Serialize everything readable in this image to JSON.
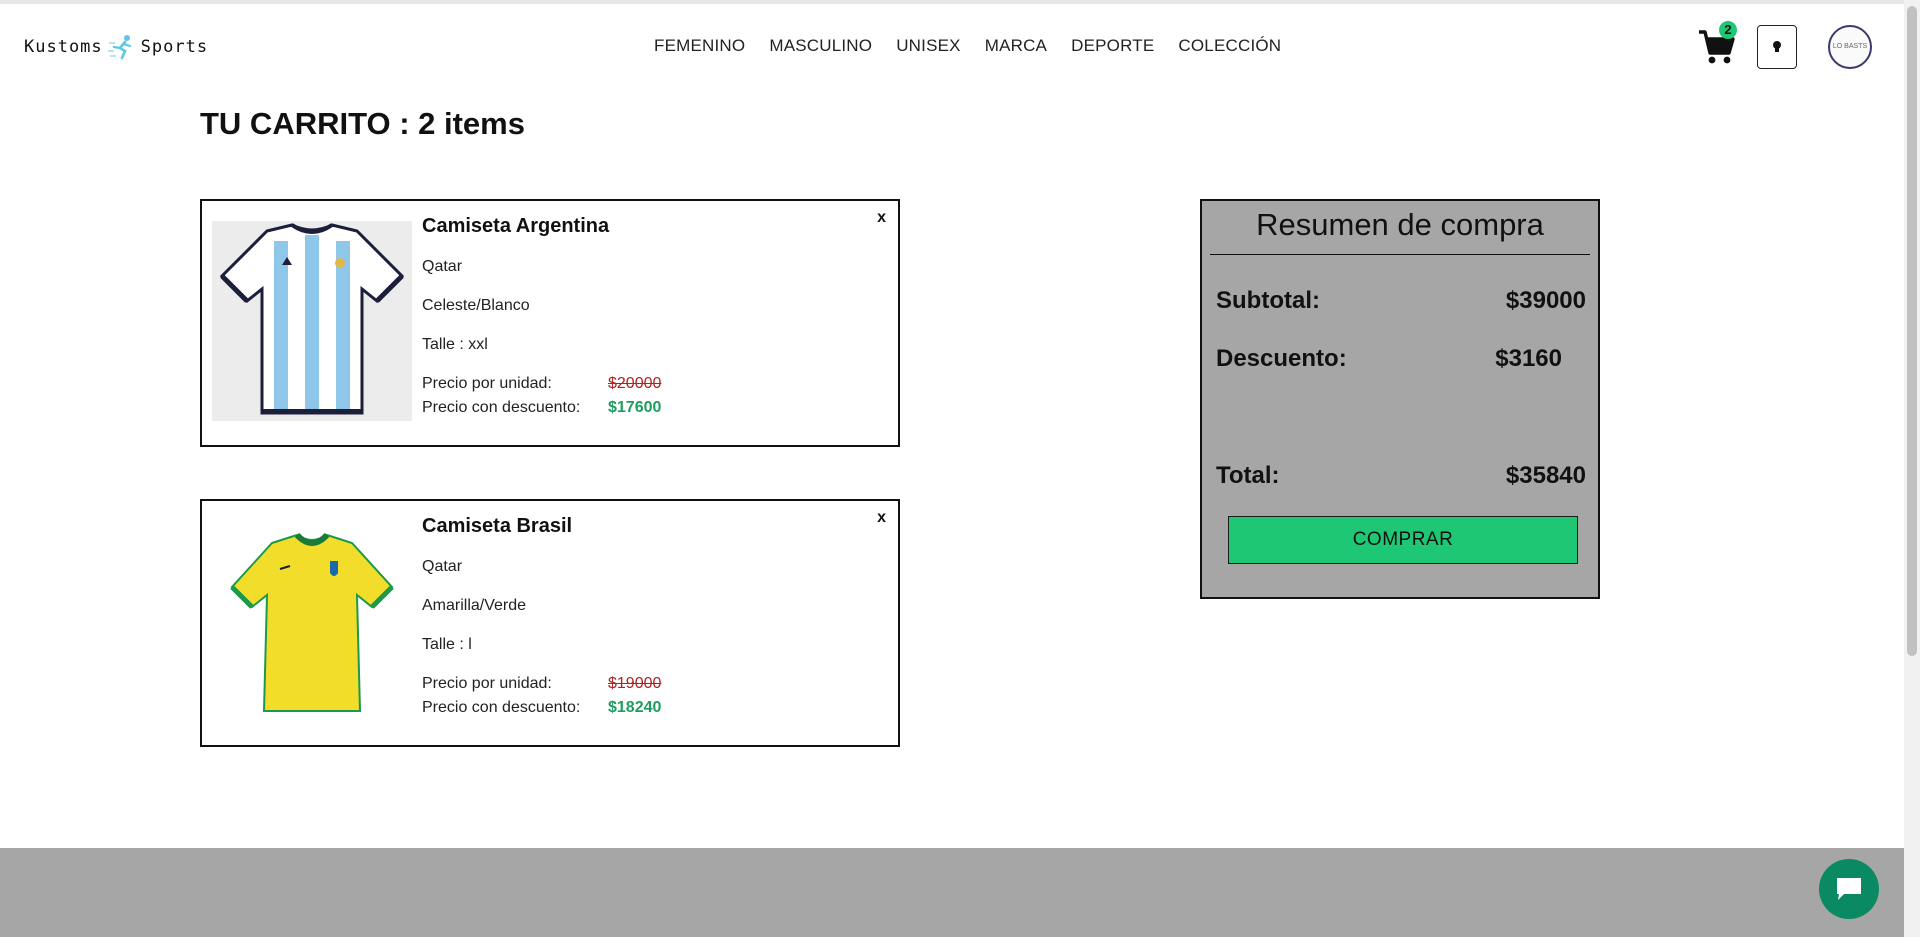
{
  "brand": {
    "left": "Kustoms",
    "right": "Sports"
  },
  "nav": [
    "FEMENINO",
    "MASCULINO",
    "UNISEX",
    "MARCA",
    "DEPORTE",
    "COLECCIÓN"
  ],
  "header": {
    "cart_count": "2",
    "avatar_text": "LO BASTS"
  },
  "cart": {
    "title": "TU CARRITO : 2 items",
    "items": [
      {
        "name": "Camiseta Argentina",
        "collection": "Qatar",
        "color": "Celeste/Blanco",
        "size": "Talle : xxl",
        "unit_label": "Precio por unidad:",
        "unit_price": "$20000",
        "discount_label": "Precio con descuento:",
        "discount_price": "$17600",
        "remove": "x",
        "image_icon": "argentina-jersey-image"
      },
      {
        "name": "Camiseta Brasil",
        "collection": "Qatar",
        "color": "Amarilla/Verde",
        "size": "Talle : l",
        "unit_label": "Precio por unidad:",
        "unit_price": "$19000",
        "discount_label": "Precio con descuento:",
        "discount_price": "$18240",
        "remove": "x",
        "image_icon": "brasil-jersey-image"
      }
    ]
  },
  "summary": {
    "title": "Resumen de compra",
    "subtotal_label": "Subtotal:",
    "subtotal": "$39000",
    "discount_label": "Descuento:",
    "discount": "$3160",
    "total_label": "Total:",
    "total": "$35840",
    "buy_label": "COMPRAR"
  },
  "colors": {
    "accent_green": "#1ec773",
    "price_green": "#1e9e5e",
    "strike_red": "#b22222",
    "summary_bg": "#a6a6a6",
    "footer_bg": "#a6a6a6",
    "chat_bg": "#0a8a63"
  }
}
